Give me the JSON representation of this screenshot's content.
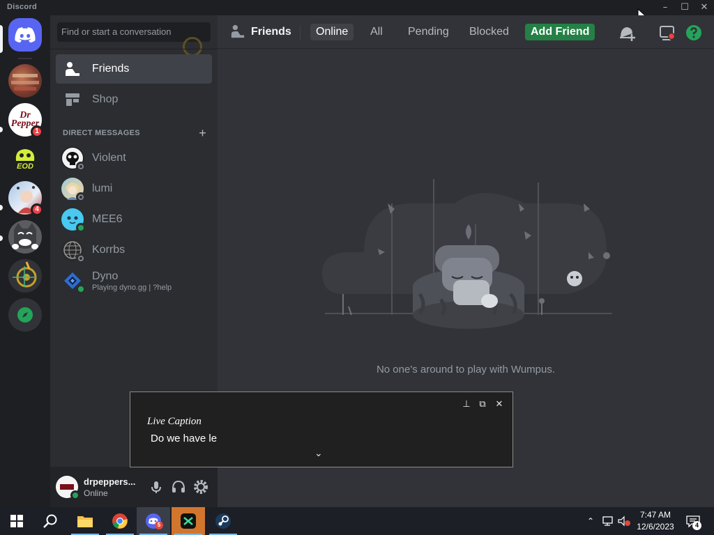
{
  "window": {
    "title": "Discord"
  },
  "servers": [
    {
      "name": "home",
      "badge": ""
    },
    {
      "name": "server-food",
      "badge": ""
    },
    {
      "name": "server-dr-pepper",
      "badge": "1",
      "logo_text": "Dr Pepper"
    },
    {
      "name": "server-eod",
      "badge": "",
      "logo_text": "EOD"
    },
    {
      "name": "server-anime",
      "badge": "4"
    },
    {
      "name": "server-cat",
      "badge": ""
    },
    {
      "name": "server-targets",
      "badge": ""
    },
    {
      "name": "explore-servers",
      "badge": ""
    }
  ],
  "sidebar": {
    "search_placeholder": "Find or start a conversation",
    "nav": [
      {
        "label": "Friends",
        "icon": "friends-icon"
      },
      {
        "label": "Shop",
        "icon": "shop-icon"
      }
    ],
    "dm_header": "DIRECT MESSAGES",
    "dm_add": "+",
    "dms": [
      {
        "name": "Violent",
        "status": "offline",
        "subtitle": ""
      },
      {
        "name": "lumi",
        "status": "offline",
        "subtitle": ""
      },
      {
        "name": "MEE6",
        "status": "online",
        "subtitle": ""
      },
      {
        "name": "Korrbs",
        "status": "offline",
        "subtitle": ""
      },
      {
        "name": "Dyno",
        "status": "online",
        "subtitle": "Playing dyno.gg | ?help"
      }
    ]
  },
  "user_panel": {
    "username": "drpeppers...",
    "status": "Online",
    "controls": [
      "mic-icon",
      "headphones-icon",
      "settings-icon"
    ]
  },
  "topbar": {
    "title": "Friends",
    "tabs": [
      "Online",
      "All",
      "Pending",
      "Blocked"
    ],
    "selected_tab": "Online",
    "add_friend": "Add Friend",
    "icons": [
      "new-group-dm-icon",
      "inbox-icon",
      "help-icon"
    ]
  },
  "main": {
    "empty_message": "No one's around to play with Wumpus."
  },
  "live_caption": {
    "title": "Live Caption",
    "text": "Do we have le",
    "buttons": [
      "pin-icon",
      "resize-icon",
      "close-icon"
    ],
    "expand": "⌄"
  },
  "taskbar": {
    "apps": [
      "start-icon",
      "search-icon",
      "file-explorer-icon",
      "chrome-icon",
      "discord-icon",
      "capcut-icon",
      "steam-icon"
    ],
    "discord_badge": "5",
    "time": "7:47 AM",
    "date": "12/6/2023",
    "notification_count": "4"
  },
  "colors": {
    "blurple": "#5865f2",
    "green": "#248046",
    "online": "#23a559",
    "offline": "#80848e",
    "red_badge": "#f23f43"
  }
}
